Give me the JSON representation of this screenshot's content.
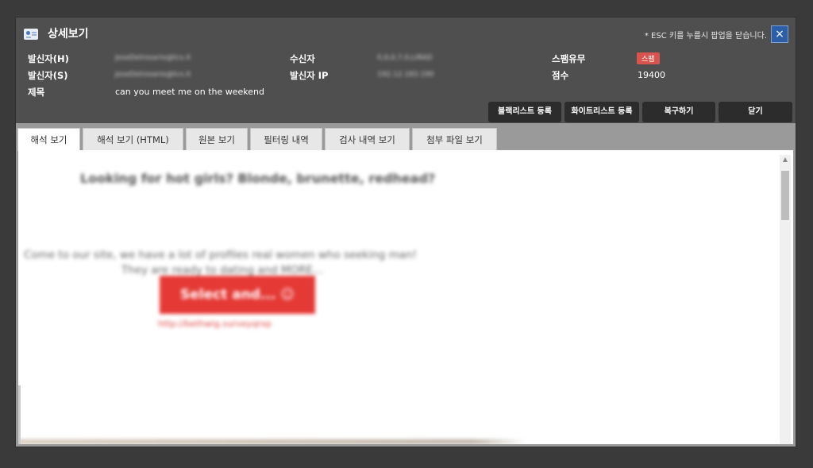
{
  "header": {
    "title": "상세보기",
    "esc_note": "* ESC 키를 누를시 팝업을 닫습니다.",
    "close_label": "×"
  },
  "info": {
    "sender_h_label": "발신자(H)",
    "sender_h_value": "JoseDelrosario@tcs.it",
    "sender_s_label": "발신자(S)",
    "sender_s_value": "JoseDelrosario@tcs.it",
    "subject_label": "제목",
    "subject_value": "can you meet me on the weekend",
    "recipient_label": "수신자",
    "recipient_value": "0,0,0,7,0,LIRAD",
    "sender_ip_label": "발신자 IP",
    "sender_ip_value": "192.12.183.190",
    "spam_label": "스팸유무",
    "spam_badge": "스팸",
    "score_label": "점수",
    "score_value": "19400"
  },
  "actions": {
    "blacklist": "블랙리스트 등록",
    "whitelist": "화이트리스트 등록",
    "restore": "복구하기",
    "close": "닫기"
  },
  "tabs": [
    {
      "label": "해석 보기"
    },
    {
      "label": "해석 보기 (HTML)"
    },
    {
      "label": "원본 보기"
    },
    {
      "label": "필터링 내역"
    },
    {
      "label": "검사 내역 보기"
    },
    {
      "label": "첨부 파일 보기"
    }
  ],
  "mail": {
    "headline": "Looking for hot girls? Blonde, brunette, redhead?",
    "line1": "Come to our site, we have a lot of profiles real women who seeking man!",
    "line2": "They are ready to dating and MORE...",
    "cta": "Select and... ☺",
    "link": "http://bethwig.surveyqrxp"
  },
  "colors": {
    "spam_badge": "#d9534f",
    "close_button": "#2d5fa8",
    "cta": "#e53935"
  },
  "icons": {
    "title": "card-icon",
    "close": "close-icon",
    "scroll_up": "scroll-up-arrow-icon"
  }
}
